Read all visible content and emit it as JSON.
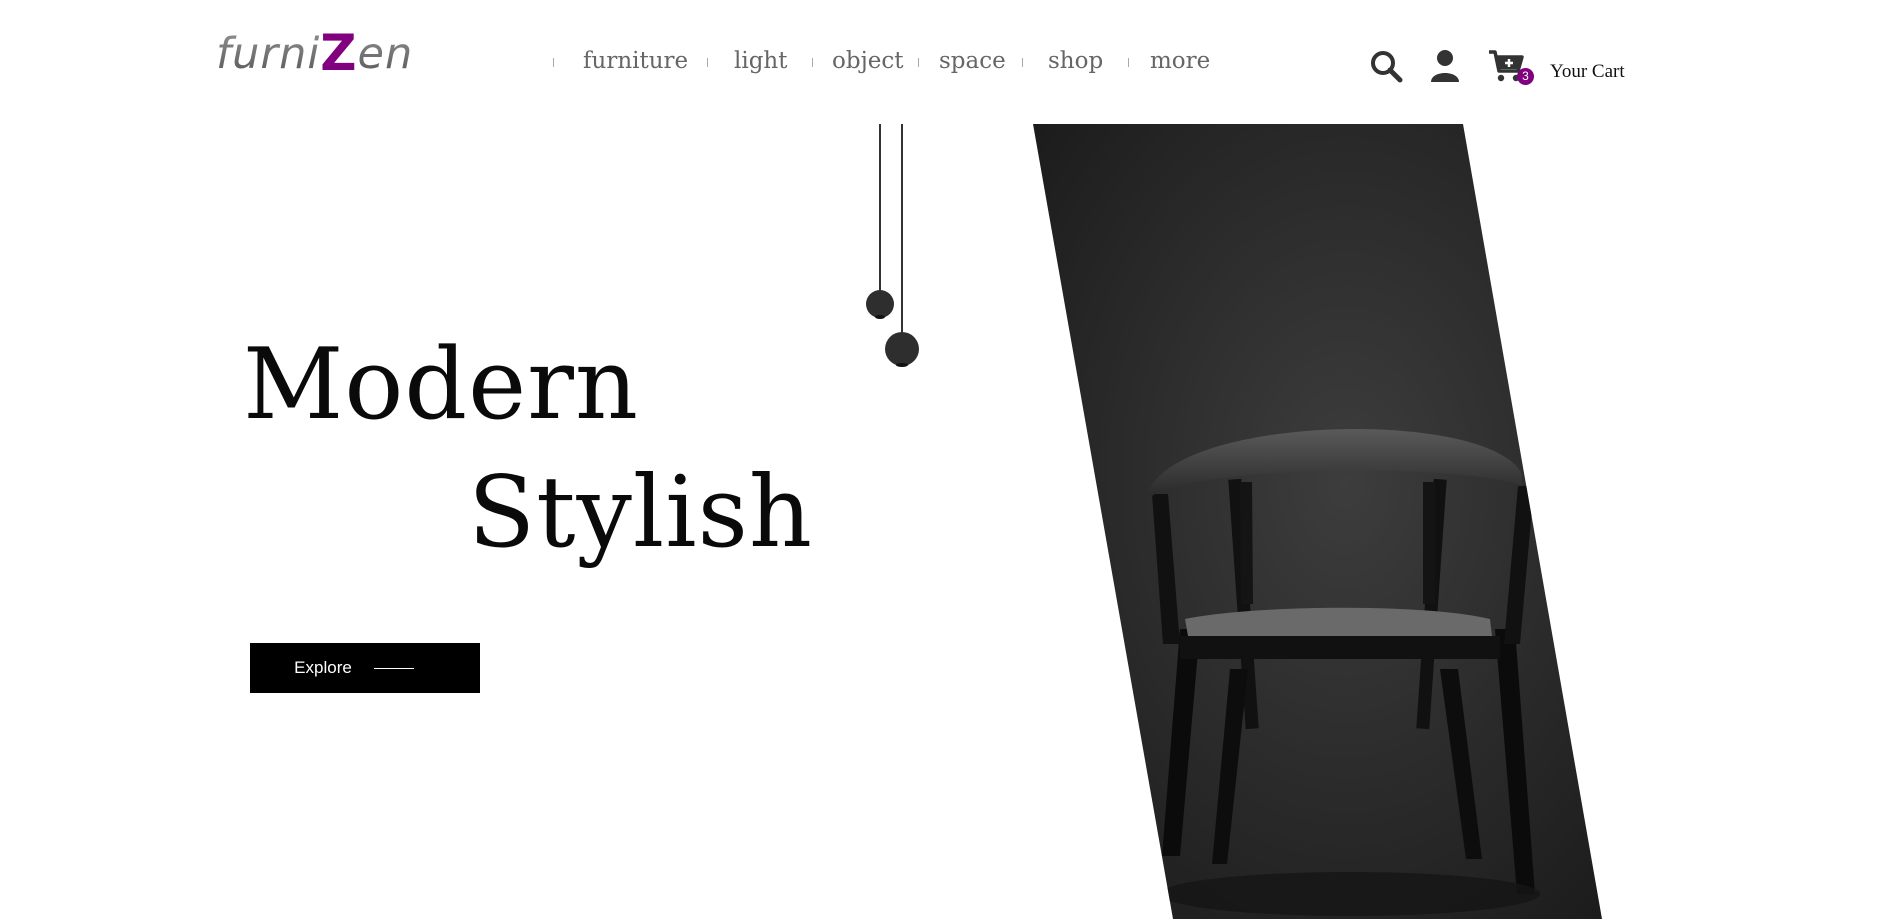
{
  "brand": {
    "logo_prefix": "furni",
    "logo_accent": "Z",
    "logo_suffix": "en",
    "accent_color": "#800080"
  },
  "nav": {
    "items": [
      "furniture",
      "light",
      "object",
      "space",
      "shop",
      "more"
    ]
  },
  "header": {
    "icons": [
      "search-icon",
      "user-icon",
      "cart-plus-icon"
    ],
    "cart_count": "3",
    "cart_label": "Your Cart"
  },
  "hero": {
    "title_line1": "Modern",
    "title_line2": "Stylish",
    "cta_label": "Explore"
  }
}
